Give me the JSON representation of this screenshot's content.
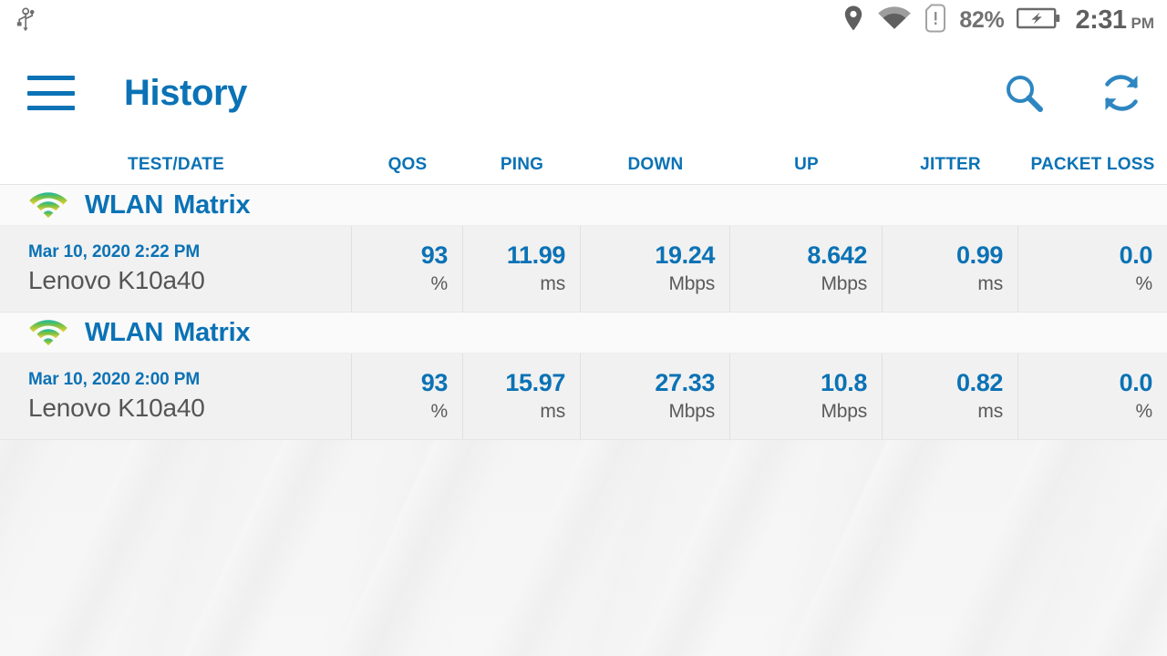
{
  "statusbar": {
    "usb_icon": "usb-icon",
    "location_icon": "location-pin-icon",
    "wifi_icon": "wifi-icon",
    "sim_icon": "sim-card-alert-icon",
    "battery_percent": "82%",
    "battery_icon": "battery-charging-icon",
    "time": "2:31",
    "ampm": "PM"
  },
  "appbar": {
    "menu_icon": "hamburger-menu-icon",
    "title": "History",
    "search_icon": "search-icon",
    "refresh_icon": "refresh-icon"
  },
  "columns": {
    "test_date": "TEST/DATE",
    "qos": "QOS",
    "ping": "PING",
    "down": "DOWN",
    "up": "UP",
    "jitter": "JITTER",
    "packet_loss": "PACKET LOSS"
  },
  "colors": {
    "accent_blue": "#0b72b5",
    "device_gray": "#555555",
    "unit_gray": "#5a5a5a",
    "row_bg": "#f1f1f1",
    "group_bg": "#fafafa"
  },
  "groups": [
    {
      "connection_type": "WLAN",
      "network_name": "Matrix",
      "signal_icon": "wifi-signal-icon",
      "row": {
        "date": "Mar 10, 2020 2:22 PM",
        "device": "Lenovo K10a40",
        "qos": {
          "value": "93",
          "unit": "%"
        },
        "ping": {
          "value": "11.99",
          "unit": "ms"
        },
        "down": {
          "value": "19.24",
          "unit": "Mbps"
        },
        "up": {
          "value": "8.642",
          "unit": "Mbps"
        },
        "jitter": {
          "value": "0.99",
          "unit": "ms"
        },
        "packet_loss": {
          "value": "0.0",
          "unit": "%"
        }
      }
    },
    {
      "connection_type": "WLAN",
      "network_name": "Matrix",
      "signal_icon": "wifi-signal-icon",
      "row": {
        "date": "Mar 10, 2020 2:00 PM",
        "device": "Lenovo K10a40",
        "qos": {
          "value": "93",
          "unit": "%"
        },
        "ping": {
          "value": "15.97",
          "unit": "ms"
        },
        "down": {
          "value": "27.33",
          "unit": "Mbps"
        },
        "up": {
          "value": "10.8",
          "unit": "Mbps"
        },
        "jitter": {
          "value": "0.82",
          "unit": "ms"
        },
        "packet_loss": {
          "value": "0.0",
          "unit": "%"
        }
      }
    }
  ]
}
